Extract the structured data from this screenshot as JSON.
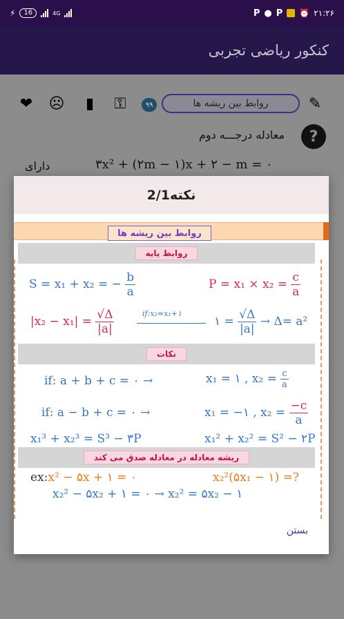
{
  "status_bar": {
    "time": "۲۱:۲۶",
    "battery": "16",
    "network": "4G"
  },
  "app_bar": {
    "title": "کنکور ریاضی تجربی"
  },
  "toolbar": {
    "pill_label": "روابط بین ریشه ها",
    "badge": "۹۹"
  },
  "background": {
    "question_label": "معادله درجـــه دوم",
    "equation": "۳x² + (۲m − ۱)x + ۲ − m = ۰",
    "having": "دارای"
  },
  "dialog": {
    "title": "نکته2/1",
    "note_title": "روابط بین ریشه ها",
    "section_basic": "روابط پایه",
    "section_notes": "نکات",
    "section_roots": "ریشه معادله در معادله صدق می کند",
    "f_sum_lhs": "S = x₁ + x₂ = −",
    "f_sum_num": "b",
    "f_sum_den": "a",
    "f_prod_lhs": "P = x₁ × x₂ =",
    "f_prod_num": "c",
    "f_prod_den": "a",
    "f_diff_lhs": "|x₂ − x₁| =",
    "f_diff_num": "√Δ",
    "f_diff_den": "|a|",
    "f_cond": "if:x₂=x₁+۱",
    "f_one_lhs": "۱ =",
    "f_one_num": "√Δ",
    "f_one_den": "|a|",
    "f_one_rhs": "→ Δ= a²",
    "f_if1": "if: a + b + c = ۰   →",
    "f_if1_rhs": "x₁ = ۱ , x₂ =",
    "f_if1_num": "c",
    "f_if1_den": "a",
    "f_if2": "if: a − b + c = ۰   →",
    "f_if2_rhs": "x₁ = −۱ , x₂ =",
    "f_if2_num": "−c",
    "f_if2_den": "a",
    "f_cube": "x₁³ + x₂³ = S³ − ۳P",
    "f_square": "x₁² + x₂² = S² − ۲P",
    "f_ex": "ex:",
    "f_ex_eq": "x² − ۵x + ۱ = ۰",
    "f_ex_q": "x₂²(۵x₁ − ۱) =?",
    "f_ex_sub": "x₂² − ۵x₂ + ۱ = ۰ → x₂² = ۵x₂ − ۱",
    "close_label": "بستن"
  }
}
